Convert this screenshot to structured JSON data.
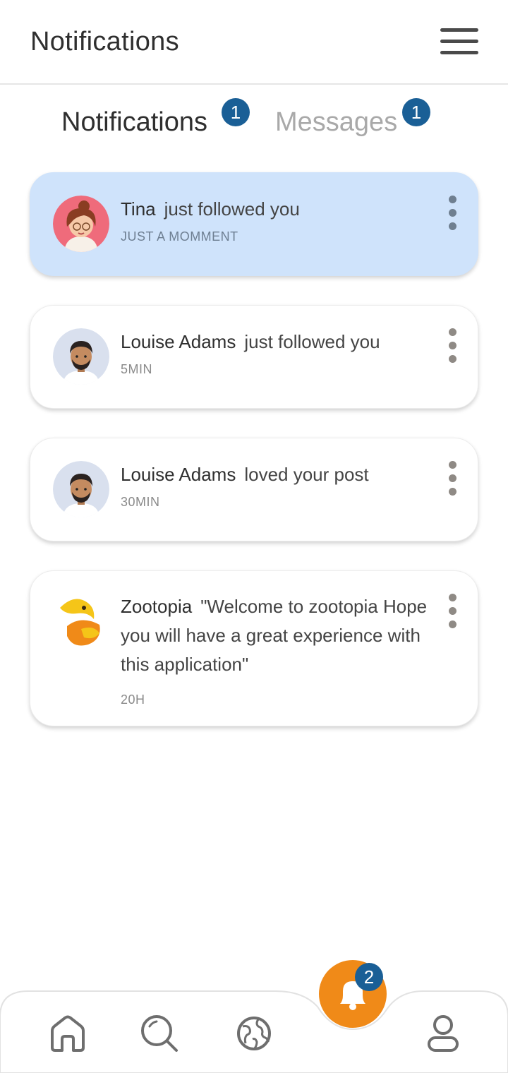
{
  "header": {
    "title": "Notifications",
    "menu_icon": "hamburger-menu-icon"
  },
  "tabs": [
    {
      "label": "Notifications",
      "badge": "1",
      "active": true
    },
    {
      "label": "Messages",
      "badge": "1",
      "active": false
    }
  ],
  "notifications": [
    {
      "name": "Tina",
      "text": "just followed you",
      "time": "JUST A MOMMENT",
      "avatar": "woman-avatar",
      "highlighted": true
    },
    {
      "name": "Louise Adams",
      "text": "just followed you",
      "time": "5MIN",
      "avatar": "man-avatar",
      "highlighted": false
    },
    {
      "name": "Louise Adams",
      "text": "loved your post",
      "time": "30MIN",
      "avatar": "man-avatar",
      "highlighted": false
    },
    {
      "name": "Zootopia",
      "text": "\"Welcome to zootopia Hope you will have a great experience with this application\"",
      "time": "20H",
      "avatar": "zootopia-logo",
      "highlighted": false
    }
  ],
  "bottom_nav": {
    "items": [
      "home-icon",
      "search-icon",
      "globe-icon",
      "bell-icon",
      "profile-icon"
    ],
    "bell_badge": "2"
  },
  "colors": {
    "accent": "#f08a18",
    "badge": "#1a5f96",
    "highlight": "#cfe3fb"
  }
}
